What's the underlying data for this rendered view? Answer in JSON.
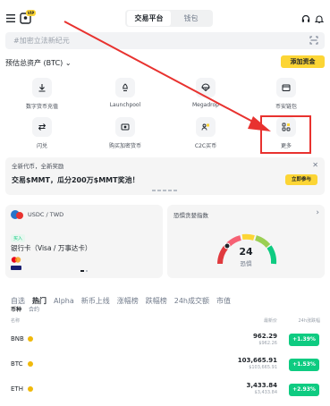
{
  "header": {
    "tabs": [
      "交易平台",
      "钱包"
    ],
    "active_tab": 0,
    "vip_badge": "VIP"
  },
  "search": {
    "placeholder": "#加密立法新纪元"
  },
  "assets": {
    "label": "预估总资产 (BTC) ⌄",
    "add_funds": "添加资金"
  },
  "shortcuts": [
    {
      "label": "数字货币充值",
      "icon": "download-icon"
    },
    {
      "label": "Launchpool",
      "icon": "rocket-icon"
    },
    {
      "label": "Megadrop",
      "icon": "parachute-icon"
    },
    {
      "label": "币安链包",
      "icon": "wallet-icon"
    },
    {
      "label": "闪兑",
      "icon": "swap-icon"
    },
    {
      "label": "购买加密货币",
      "icon": "buy-crypto-icon"
    },
    {
      "label": "C2C买币",
      "icon": "c2c-icon"
    },
    {
      "label": "更多",
      "icon": "more-icon"
    }
  ],
  "promo": {
    "tag": "全新代币，全新奖励",
    "text": "交易$MMT，瓜分200万$MMT奖池！",
    "button": "立即参与"
  },
  "fiat_card": {
    "pair": "USDC / TWD",
    "tag": "买入",
    "method": "银行卡（Visa / 万事达卡）"
  },
  "fear_greed": {
    "title": "恐惧贪婪指数",
    "value": "24",
    "label": "恐惧"
  },
  "market": {
    "tabs": [
      "自选",
      "热门",
      "Alpha",
      "新币上线",
      "涨幅榜",
      "跌幅榜",
      "24h成交额",
      "市值"
    ],
    "active_tab": 1,
    "sub_tabs": [
      "币种",
      "合约"
    ],
    "columns": {
      "name": "名称",
      "price": "最新价",
      "change": "24h涨跌幅"
    },
    "rows": [
      {
        "symbol": "BNB",
        "price": "962.29",
        "sub": "$962.26",
        "change": "+1.39%"
      },
      {
        "symbol": "BTC",
        "price": "103,665.91",
        "sub": "$103,665.91",
        "change": "+1.53%"
      },
      {
        "symbol": "ETH",
        "price": "3,433.84",
        "sub": "$3,433.84",
        "change": "+2.93%"
      }
    ]
  },
  "colors": {
    "accent": "#fcd535",
    "positive": "#0ecb81",
    "annotation": "#e8322f"
  }
}
